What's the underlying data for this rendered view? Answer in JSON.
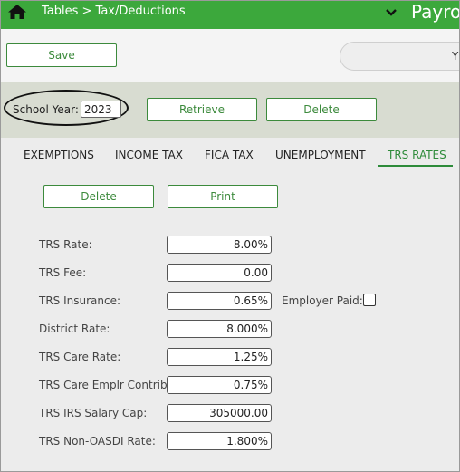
{
  "header": {
    "breadcrumb": "Tables > Tax/Deductions",
    "app_title": "Payro"
  },
  "toolbar": {
    "save_label": "Save",
    "search_visible_text": "Yc"
  },
  "year_bar": {
    "label": "School Year:",
    "value": "2023",
    "retrieve_label": "Retrieve",
    "delete_label": "Delete"
  },
  "tabs": [
    {
      "label": "EXEMPTIONS",
      "active": false
    },
    {
      "label": "INCOME TAX",
      "active": false
    },
    {
      "label": "FICA TAX",
      "active": false
    },
    {
      "label": "UNEMPLOYMENT",
      "active": false
    },
    {
      "label": "TRS RATES",
      "active": true
    }
  ],
  "section_buttons": {
    "delete_label": "Delete",
    "print_label": "Print"
  },
  "fields": [
    {
      "label": "TRS Rate:",
      "value": "8.00%"
    },
    {
      "label": "TRS Fee:",
      "value": "0.00"
    },
    {
      "label": "TRS Insurance:",
      "value": "0.65%"
    },
    {
      "label": "District Rate:",
      "value": "8.000%"
    },
    {
      "label": "TRS Care Rate:",
      "value": "1.25%"
    },
    {
      "label": "TRS Care Emplr Contrib:",
      "value": "0.75%"
    },
    {
      "label": "TRS IRS Salary Cap:",
      "value": "305000.00"
    },
    {
      "label": "TRS Non-OASDI Rate:",
      "value": "1.800%"
    }
  ],
  "employer_paid": {
    "label": "Employer Paid:",
    "checked": false
  },
  "colors": {
    "brand_green": "#3ca83c",
    "active_tab": "#2e8b3a",
    "year_bar_bg": "#d8dcd1"
  },
  "icons": {
    "home": "home-icon",
    "dropdown": "chevron-down-icon"
  }
}
